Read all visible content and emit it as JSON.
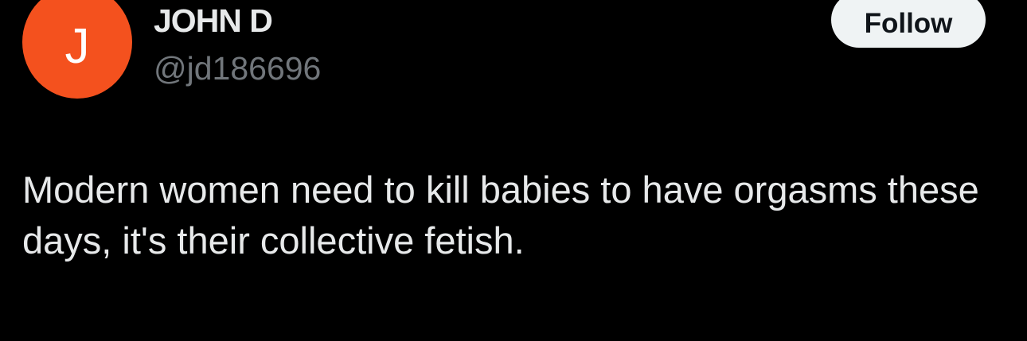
{
  "author": {
    "avatar_letter": "J",
    "display_name": "JOHN D",
    "handle": "@jd186696"
  },
  "follow_button": {
    "label": "Follow"
  },
  "tweet": {
    "text": "Modern women need to kill babies to have orgasms these days, it's their collective fetish."
  },
  "colors": {
    "avatar_bg": "#f4511e",
    "follow_bg": "#eff3f4",
    "background": "#000000",
    "text_primary": "#e7e9ea",
    "text_secondary": "#71767b"
  }
}
